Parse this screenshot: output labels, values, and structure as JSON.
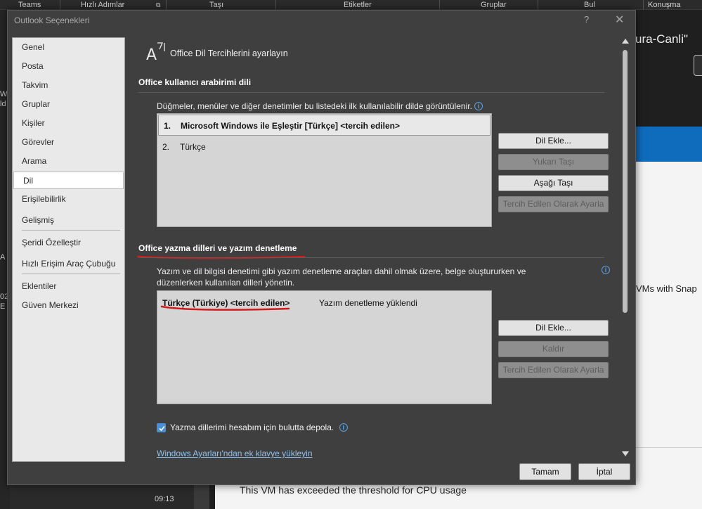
{
  "background": {
    "ribbon_groups": [
      "Teams",
      "Hızlı Adımlar",
      "Taşı",
      "Etiketler",
      "Gruplar",
      "Bul",
      "Konuşma"
    ],
    "window_title_fragment": "ura-Canli\"",
    "reading_line_1": "VMs with Snap",
    "reading_line_2": "This VM has exceeded the threshold for CPU usage",
    "left_fragments": [
      "Wa",
      "ld",
      "02",
      "E",
      "A"
    ],
    "time": "09:13"
  },
  "dialog": {
    "title": "Outlook Seçenekleri",
    "help": "?",
    "close": "✕"
  },
  "nav": {
    "items": [
      {
        "label": "Genel"
      },
      {
        "label": "Posta"
      },
      {
        "label": "Takvim"
      },
      {
        "label": "Gruplar"
      },
      {
        "label": "Kişiler"
      },
      {
        "label": "Görevler"
      },
      {
        "label": "Arama"
      },
      {
        "label": "Dil"
      },
      {
        "label": "Erişilebilirlik"
      },
      {
        "label": "Gelişmiş"
      },
      {
        "label": "Şeridi Özelleştir"
      },
      {
        "label": "Hızlı Erişim Araç Çubuğu"
      },
      {
        "label": "Eklentiler"
      },
      {
        "label": "Güven Merkezi"
      }
    ],
    "selected": "Dil"
  },
  "header": {
    "title": "Office Dil Tercihlerini ayarlayın",
    "icon": "language-icon"
  },
  "ui_language": {
    "section_title": "Office kullanıcı arabirimi dili",
    "description": "Düğmeler, menüler ve diğer denetimler bu listedeki ilk kullanılabilir dilde görüntülenir.",
    "items": [
      {
        "num": "1.",
        "label": "Microsoft Windows ile Eşleştir [Türkçe] <tercih edilen>"
      },
      {
        "num": "2.",
        "label": "Türkçe"
      }
    ],
    "buttons": {
      "add": "Dil Ekle...",
      "move_up": "Yukarı Taşı",
      "move_down": "Aşağı Taşı",
      "set_preferred": "Tercih Edilen Olarak Ayarla"
    }
  },
  "authoring": {
    "section_title": "Office yazma dilleri ve yazım denetleme",
    "description": "Yazım ve dil bilgisi denetimi gibi yazım denetleme araçları dahil olmak üzere, belge oluştururken ve düzenlerken kullanılan dilleri yönetin.",
    "items": [
      {
        "label": "Türkçe (Türkiye) <tercih edilen>",
        "status": "Yazım denetleme yüklendi"
      }
    ],
    "buttons": {
      "add": "Dil Ekle...",
      "remove": "Kaldır",
      "set_preferred": "Tercih Edilen Olarak Ayarla"
    },
    "checkbox_label": "Yazma dillerimi hesabım için bulutta depola.",
    "checkbox_checked": true,
    "link": "Windows Ayarları'ndan ek klavye yükleyin"
  },
  "footer": {
    "ok": "Tamam",
    "cancel": "İptal"
  },
  "colors": {
    "accent": "#4a90d9",
    "annotation": "#d11a1a"
  }
}
